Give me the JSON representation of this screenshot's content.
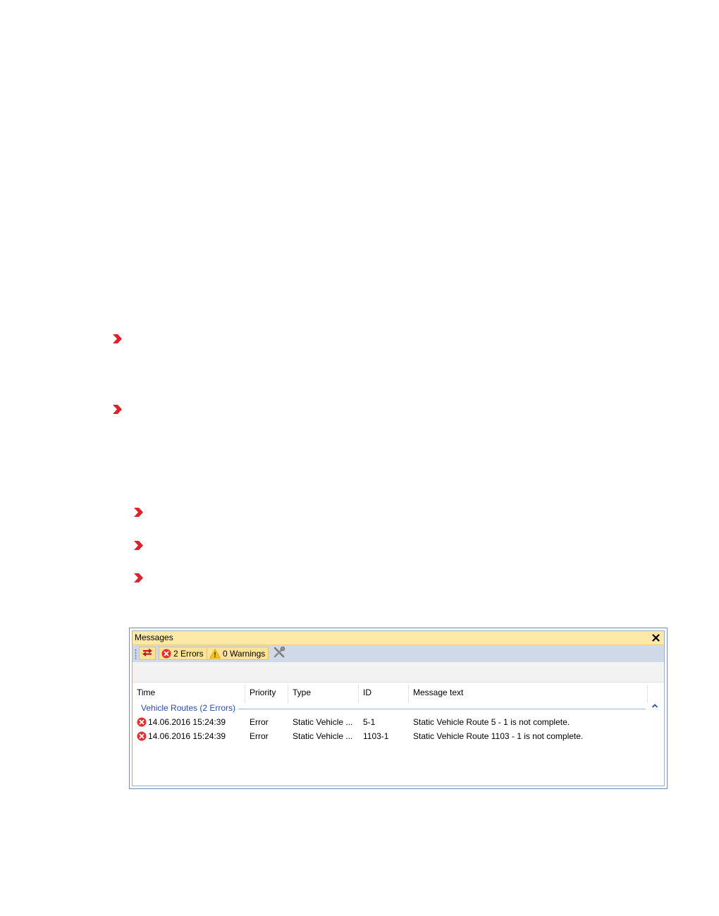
{
  "colors": {
    "bullet": "#e0202a",
    "titlebar": "#fde9a7",
    "toolbar": "#cfd9e8",
    "button_highlight": "#fde39a",
    "group_text": "#2a4ca8",
    "error": "#e03030",
    "warning": "#f5c400"
  },
  "messages_window": {
    "title": "Messages",
    "close_glyph": "✕",
    "toolbar": {
      "refresh_icon": "refresh-arrows-icon",
      "errors_label": "2 Errors",
      "warnings_label": "0 Warnings",
      "settings_icon": "tools-icon"
    },
    "columns": [
      "Time",
      "Priority",
      "Type",
      "ID",
      "Message text"
    ],
    "group": {
      "label": "Vehicle Routes (2 Errors)",
      "collapse_glyph": "^"
    },
    "rows": [
      {
        "time": "14.06.2016 15:24:39",
        "priority": "Error",
        "type": "Static Vehicle ...",
        "id": "5-1",
        "message": "Static Vehicle Route 5 - 1 is not complete."
      },
      {
        "time": "14.06.2016 15:24:39",
        "priority": "Error",
        "type": "Static Vehicle ...",
        "id": "1103-1",
        "message": "Static Vehicle Route 1103 - 1 is not complete."
      }
    ]
  }
}
